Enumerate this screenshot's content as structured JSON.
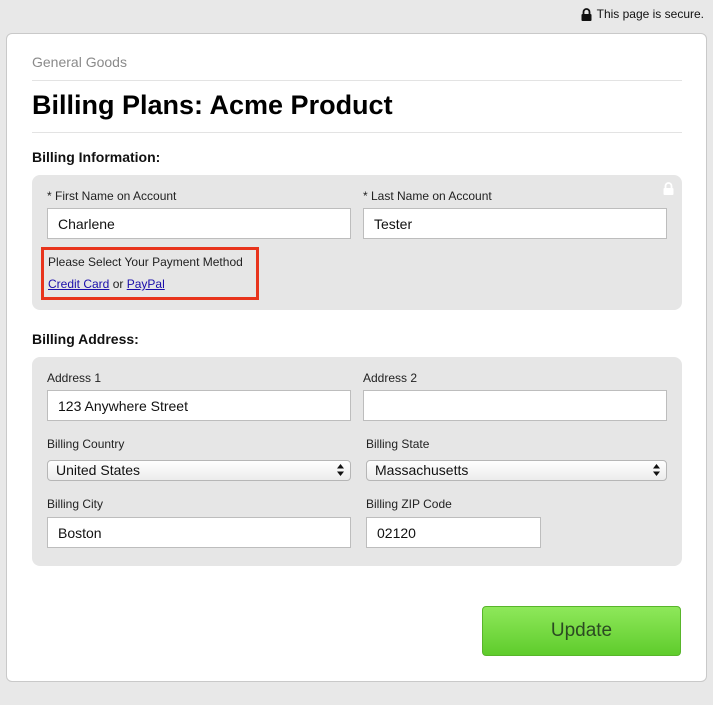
{
  "secure_notice": "This page is secure.",
  "brand": "General Goods",
  "page_title": "Billing Plans: Acme Product",
  "billing_info": {
    "heading": "Billing Information:",
    "first_name_label": "* First Name on Account",
    "first_name_value": "Charlene",
    "last_name_label": "* Last Name on Account",
    "last_name_value": "Tester",
    "payment_prompt": "Please Select Your Payment Method",
    "credit_card_link": "Credit Card",
    "or_text": "or",
    "paypal_link": "PayPal"
  },
  "billing_address": {
    "heading": "Billing Address:",
    "address1_label": "Address 1",
    "address1_value": "123 Anywhere Street",
    "address2_label": "Address 2",
    "address2_value": "",
    "country_label": "Billing Country",
    "country_value": "United States",
    "state_label": "Billing State",
    "state_value": "Massachusetts",
    "city_label": "Billing City",
    "city_value": "Boston",
    "zip_label": "Billing ZIP Code",
    "zip_value": "02120"
  },
  "update_button": "Update",
  "colors": {
    "highlight_border": "#e8341c",
    "button_green": "#7ee04a",
    "link": "#1a0dab"
  },
  "icons": [
    "lock-icon",
    "select-arrows-icon"
  ]
}
